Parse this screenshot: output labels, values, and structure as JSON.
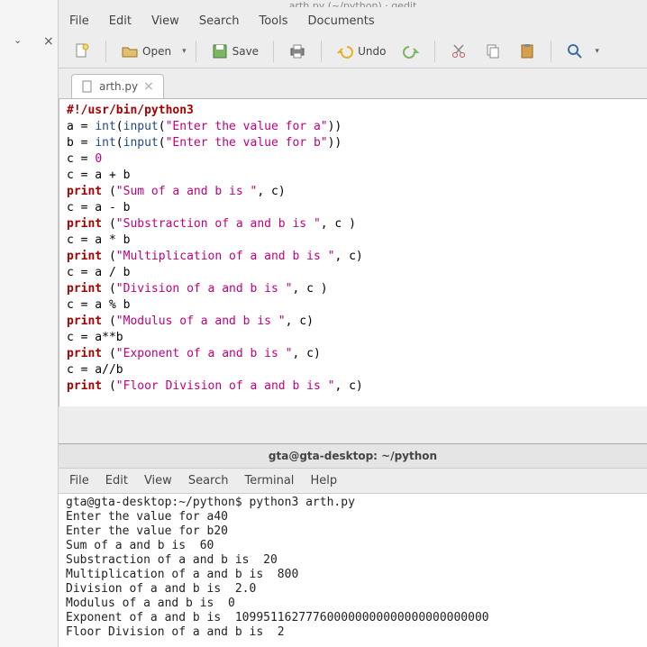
{
  "window": {
    "title_partial": "arth.py  (~/python)  ·  gedit"
  },
  "gedit": {
    "menu": {
      "file": "File",
      "edit": "Edit",
      "view": "View",
      "search": "Search",
      "tools": "Tools",
      "documents": "Documents"
    },
    "toolbar": {
      "open": "Open",
      "save": "Save",
      "undo": "Undo"
    },
    "tab": {
      "name": "arth.py"
    }
  },
  "code": {
    "l1_shebang": "#!/usr/bin/python3",
    "l2": {
      "a": "a = ",
      "fn1": "int",
      "p1": "(",
      "fn2": "input",
      "p2": "(",
      "s": "\"Enter the value for a\"",
      "p3": "))"
    },
    "l3": {
      "a": "b = ",
      "fn1": "int",
      "p1": "(",
      "fn2": "input",
      "p2": "(",
      "s": "\"Enter the value for b\"",
      "p3": "))"
    },
    "l4": {
      "a": "c = ",
      "n": "0"
    },
    "l5": "c = a + b",
    "l6": {
      "kw": "print",
      "a": " (",
      "s": "\"Sum of a and b is \"",
      "b": ", c)"
    },
    "l7": "c = a - b",
    "l8": {
      "kw": "print",
      "a": " (",
      "s": "\"Substraction of a and b is \"",
      "b": ", c )"
    },
    "l9": "c = a * b",
    "l10": {
      "kw": "print",
      "a": " (",
      "s": "\"Multiplication of a and b is \"",
      "b": ", c)"
    },
    "l11": "c = a / b",
    "l12": {
      "kw": "print",
      "a": " (",
      "s": "\"Division of a and b is \"",
      "b": ", c )"
    },
    "l13": "c = a % b",
    "l14": {
      "kw": "print",
      "a": " (",
      "s": "\"Modulus of a and b is \"",
      "b": ", c)"
    },
    "l15": "c = a**b",
    "l16": {
      "kw": "print",
      "a": " (",
      "s": "\"Exponent of a and b is \"",
      "b": ", c)"
    },
    "l17": "c = a//b",
    "l18": {
      "kw": "print",
      "a": " (",
      "s": "\"Floor Division of a and b is \"",
      "b": ", c)"
    }
  },
  "terminal": {
    "title": "gta@gta-desktop: ~/python",
    "menu": {
      "file": "File",
      "edit": "Edit",
      "view": "View",
      "search": "Search",
      "terminal": "Terminal",
      "help": "Help"
    },
    "lines": {
      "l1": "gta@gta-desktop:~/python$ python3 arth.py",
      "l2": "Enter the value for a40",
      "l3": "Enter the value for b20",
      "l4": "Sum of a and b is  60",
      "l5": "Substraction of a and b is  20",
      "l6": "Multiplication of a and b is  800",
      "l7": "Division of a and b is  2.0",
      "l8": "Modulus of a and b is  0",
      "l9": "Exponent of a and b is  109951162777600000000000000000000000",
      "l10": "Floor Division of a and b is  2"
    }
  }
}
